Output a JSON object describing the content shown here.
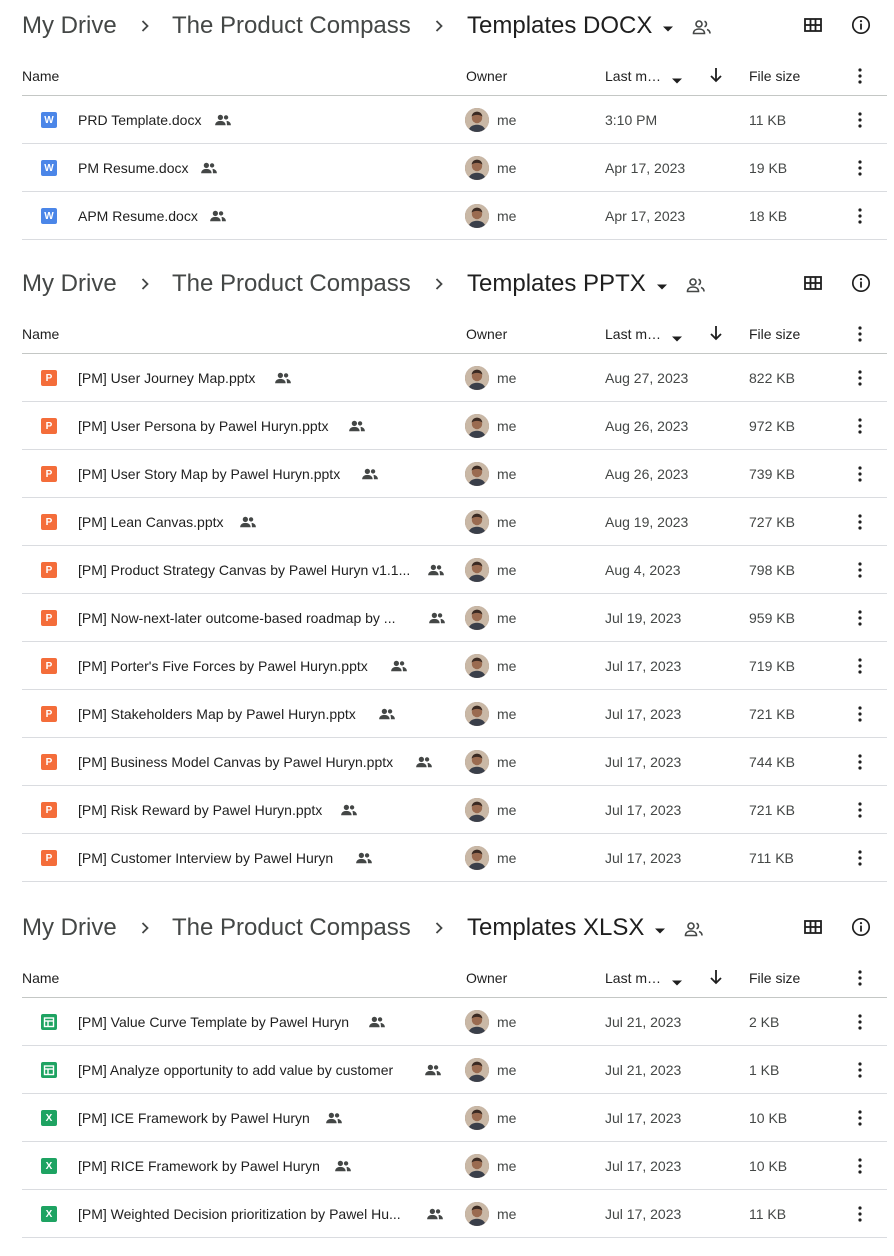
{
  "sections": [
    {
      "breadcrumb": [
        "My Drive",
        "The Product Compass",
        "Templates DOCX"
      ],
      "columns": {
        "name": "Name",
        "owner": "Owner",
        "modified": "Last m…",
        "size": "File size"
      },
      "rows": [
        {
          "type": "docx",
          "badge": "W",
          "name": "PRD Template.docx",
          "owner": "me",
          "modified": "3:10 PM",
          "size": "11 KB"
        },
        {
          "type": "docx",
          "badge": "W",
          "name": "PM Resume.docx",
          "owner": "me",
          "modified": "Apr 17, 2023",
          "size": "19 KB"
        },
        {
          "type": "docx",
          "badge": "W",
          "name": "APM Resume.docx",
          "owner": "me",
          "modified": "Apr 17, 2023",
          "size": "18 KB"
        }
      ]
    },
    {
      "breadcrumb": [
        "My Drive",
        "The Product Compass",
        "Templates PPTX"
      ],
      "columns": {
        "name": "Name",
        "owner": "Owner",
        "modified": "Last m…",
        "size": "File size"
      },
      "rows": [
        {
          "type": "pptx",
          "badge": "P",
          "name": "[PM] User Journey Map.pptx",
          "owner": "me",
          "modified": "Aug 27, 2023",
          "size": "822 KB"
        },
        {
          "type": "pptx",
          "badge": "P",
          "name": "[PM] User Persona by Pawel Huryn.pptx",
          "owner": "me",
          "modified": "Aug 26, 2023",
          "size": "972 KB"
        },
        {
          "type": "pptx",
          "badge": "P",
          "name": "[PM] User Story Map by Pawel Huryn.pptx",
          "owner": "me",
          "modified": "Aug 26, 2023",
          "size": "739 KB"
        },
        {
          "type": "pptx",
          "badge": "P",
          "name": "[PM] Lean Canvas.pptx",
          "owner": "me",
          "modified": "Aug 19, 2023",
          "size": "727 KB"
        },
        {
          "type": "pptx",
          "badge": "P",
          "name": "[PM] Product Strategy Canvas by Pawel Huryn v1.1...",
          "owner": "me",
          "modified": "Aug 4, 2023",
          "size": "798 KB"
        },
        {
          "type": "pptx",
          "badge": "P",
          "name": "[PM] Now-next-later outcome-based roadmap by ...",
          "owner": "me",
          "modified": "Jul 19, 2023",
          "size": "959 KB"
        },
        {
          "type": "pptx",
          "badge": "P",
          "name": "[PM] Porter's Five Forces by Pawel Huryn.pptx",
          "owner": "me",
          "modified": "Jul 17, 2023",
          "size": "719 KB"
        },
        {
          "type": "pptx",
          "badge": "P",
          "name": "[PM] Stakeholders Map by Pawel Huryn.pptx",
          "owner": "me",
          "modified": "Jul 17, 2023",
          "size": "721 KB"
        },
        {
          "type": "pptx",
          "badge": "P",
          "name": "[PM] Business Model Canvas by Pawel Huryn.pptx",
          "owner": "me",
          "modified": "Jul 17, 2023",
          "size": "744 KB"
        },
        {
          "type": "pptx",
          "badge": "P",
          "name": "[PM] Risk Reward by Pawel Huryn.pptx",
          "owner": "me",
          "modified": "Jul 17, 2023",
          "size": "721 KB"
        },
        {
          "type": "pptx",
          "badge": "P",
          "name": "[PM] Customer Interview by Pawel Huryn",
          "owner": "me",
          "modified": "Jul 17, 2023",
          "size": "711 KB"
        }
      ]
    },
    {
      "breadcrumb": [
        "My Drive",
        "The Product Compass",
        "Templates XLSX"
      ],
      "columns": {
        "name": "Name",
        "owner": "Owner",
        "modified": "Last m…",
        "size": "File size"
      },
      "rows": [
        {
          "type": "gsheet",
          "badge": "",
          "name": "[PM] Value Curve Template by Pawel Huryn",
          "owner": "me",
          "modified": "Jul 21, 2023",
          "size": "2 KB"
        },
        {
          "type": "gsheet",
          "badge": "",
          "name": "[PM] Analyze opportunity to add value by customer",
          "owner": "me",
          "modified": "Jul 21, 2023",
          "size": "1 KB"
        },
        {
          "type": "xlsx",
          "badge": "X",
          "name": "[PM] ICE Framework by Pawel Huryn",
          "owner": "me",
          "modified": "Jul 17, 2023",
          "size": "10 KB"
        },
        {
          "type": "xlsx",
          "badge": "X",
          "name": "[PM] RICE Framework by Pawel Huryn",
          "owner": "me",
          "modified": "Jul 17, 2023",
          "size": "10 KB"
        },
        {
          "type": "xlsx",
          "badge": "X",
          "name": "[PM] Weighted Decision prioritization by Pawel Hu...",
          "owner": "me",
          "modified": "Jul 17, 2023",
          "size": "11 KB"
        }
      ]
    }
  ],
  "icons": {
    "breadcrumb_separator": "chevron-right-icon",
    "folder_dropdown": "caret-down-icon",
    "folder_shared": "shared-people-icon",
    "grid_view": "grid-view-icon",
    "details": "info-icon",
    "sort": "arrow-down-icon",
    "row_more": "more-vert-icon",
    "row_shared": "shared-people-icon"
  },
  "colors": {
    "docx": "#4b86e8",
    "pptx": "#f46d3a",
    "xlsx": "#1ea362",
    "divider": "#dadce0",
    "text_secondary": "#444746"
  }
}
